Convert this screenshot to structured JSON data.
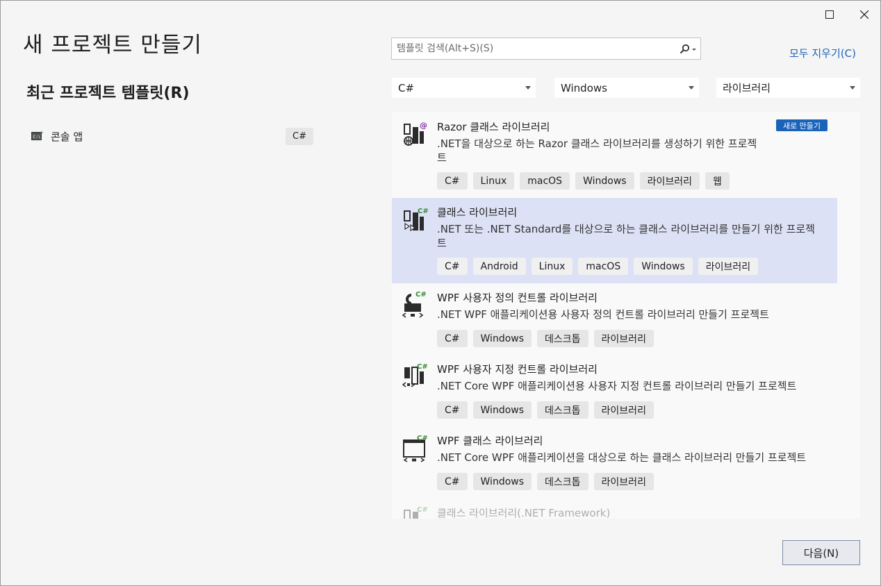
{
  "window": {
    "title": "새 프로젝트 만들기",
    "recent_title": "최근 프로젝트 템플릿(R)"
  },
  "recent": [
    {
      "label": "콘솔 앱",
      "lang": "C#"
    }
  ],
  "search": {
    "placeholder": "템플릿 검색(Alt+S)(S)",
    "clear_label": "모두 지우기(C)"
  },
  "filters": {
    "language": "C#",
    "platform": "Windows",
    "project_type": "라이브러리"
  },
  "templates": [
    {
      "name": "Razor 클래스 라이브러리",
      "desc_line1": ".NET을 대상으로 하는 Razor 클래스 라이브러리를 생성하기 위한 프로젝",
      "desc_line2": "트",
      "badge": "새로 만들기",
      "tags": [
        "C#",
        "Linux",
        "macOS",
        "Windows",
        "라이브러리",
        "웹"
      ]
    },
    {
      "name": "클래스 라이브러리",
      "desc_line1": ".NET 또는 .NET Standard를 대상으로 하는 클래스 라이브러리를 만들기 위한 프로젝",
      "desc_line2": "트",
      "tags": [
        "C#",
        "Android",
        "Linux",
        "macOS",
        "Windows",
        "라이브러리"
      ]
    },
    {
      "name": "WPF 사용자 정의 컨트롤 라이브러리",
      "desc_line1": ".NET WPF 애플리케이션용 사용자 정의 컨트롤 라이브러리 만들기 프로젝트",
      "tags": [
        "C#",
        "Windows",
        "데스크톱",
        "라이브러리"
      ]
    },
    {
      "name": "WPF 사용자 지정 컨트롤 라이브러리",
      "desc_line1": ".NET Core WPF 애플리케이션용 사용자 지정 컨트롤 라이브러리 만들기 프로젝트",
      "tags": [
        "C#",
        "Windows",
        "데스크톱",
        "라이브러리"
      ]
    },
    {
      "name": "WPF 클래스 라이브러리",
      "desc_line1": ".NET Core WPF 애플리케이션을 대상으로 하는 클래스 라이브러리 만들기 프로젝트",
      "tags": [
        "C#",
        "Windows",
        "데스크톱",
        "라이브러리"
      ]
    },
    {
      "name": "클래스 라이브러리(.NET Framework)"
    }
  ],
  "footer": {
    "next_label": "다음(N)"
  },
  "colors": {
    "accent": "#1a63b8",
    "selected_row": "#dde1f5",
    "csharp_green": "#388a34",
    "icon_dark": "#2b2b2b"
  }
}
